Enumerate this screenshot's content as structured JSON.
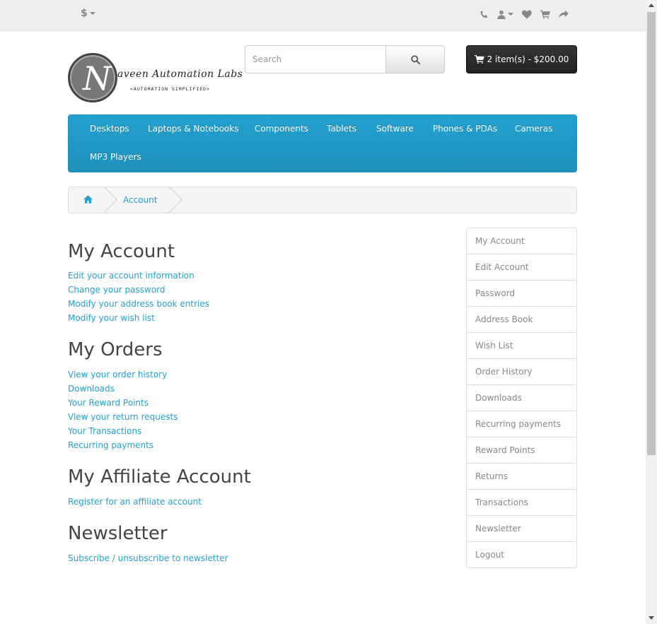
{
  "top_bar": {
    "currency": "$",
    "icons": [
      "phone-icon",
      "user-icon",
      "heart-icon",
      "shopping-cart-icon",
      "share-icon"
    ]
  },
  "logo": {
    "letter": "N",
    "title": "aveen Automation Labs",
    "subtitle": "<AUTOMATION SIMPLIFIED>"
  },
  "search": {
    "placeholder": "Search",
    "button_icon": "search-icon"
  },
  "cart": {
    "label": "2 item(s) - $200.00"
  },
  "menu": {
    "items": [
      "Desktops",
      "Laptops & Notebooks",
      "Components",
      "Tablets",
      "Software",
      "Phones & PDAs",
      "Cameras",
      "MP3 Players"
    ]
  },
  "breadcrumb": {
    "home_icon": "home-icon",
    "current": "Account"
  },
  "sections": {
    "my_account": {
      "title": "My Account",
      "links": [
        "Edit your account information",
        "Change your password",
        "Modify your address book entries",
        "Modify your wish list"
      ]
    },
    "my_orders": {
      "title": "My Orders",
      "links": [
        "View your order history",
        "Downloads",
        "Your Reward Points",
        "View your return requests",
        "Your Transactions",
        "Recurring payments"
      ]
    },
    "affiliate": {
      "title": "My Affiliate Account",
      "links": [
        "Register for an affiliate account"
      ]
    },
    "newsletter": {
      "title": "Newsletter",
      "links": [
        "Subscribe / unsubscribe to newsletter"
      ]
    }
  },
  "sidebar": {
    "items": [
      "My Account",
      "Edit Account",
      "Password",
      "Address Book",
      "Wish List",
      "Order History",
      "Downloads",
      "Recurring payments",
      "Reward Points",
      "Returns",
      "Transactions",
      "Newsletter",
      "Logout"
    ]
  },
  "colors": {
    "link": "#23a1d1",
    "menu_bg": "#229ac8",
    "cart_bg": "#2a2a2a"
  }
}
